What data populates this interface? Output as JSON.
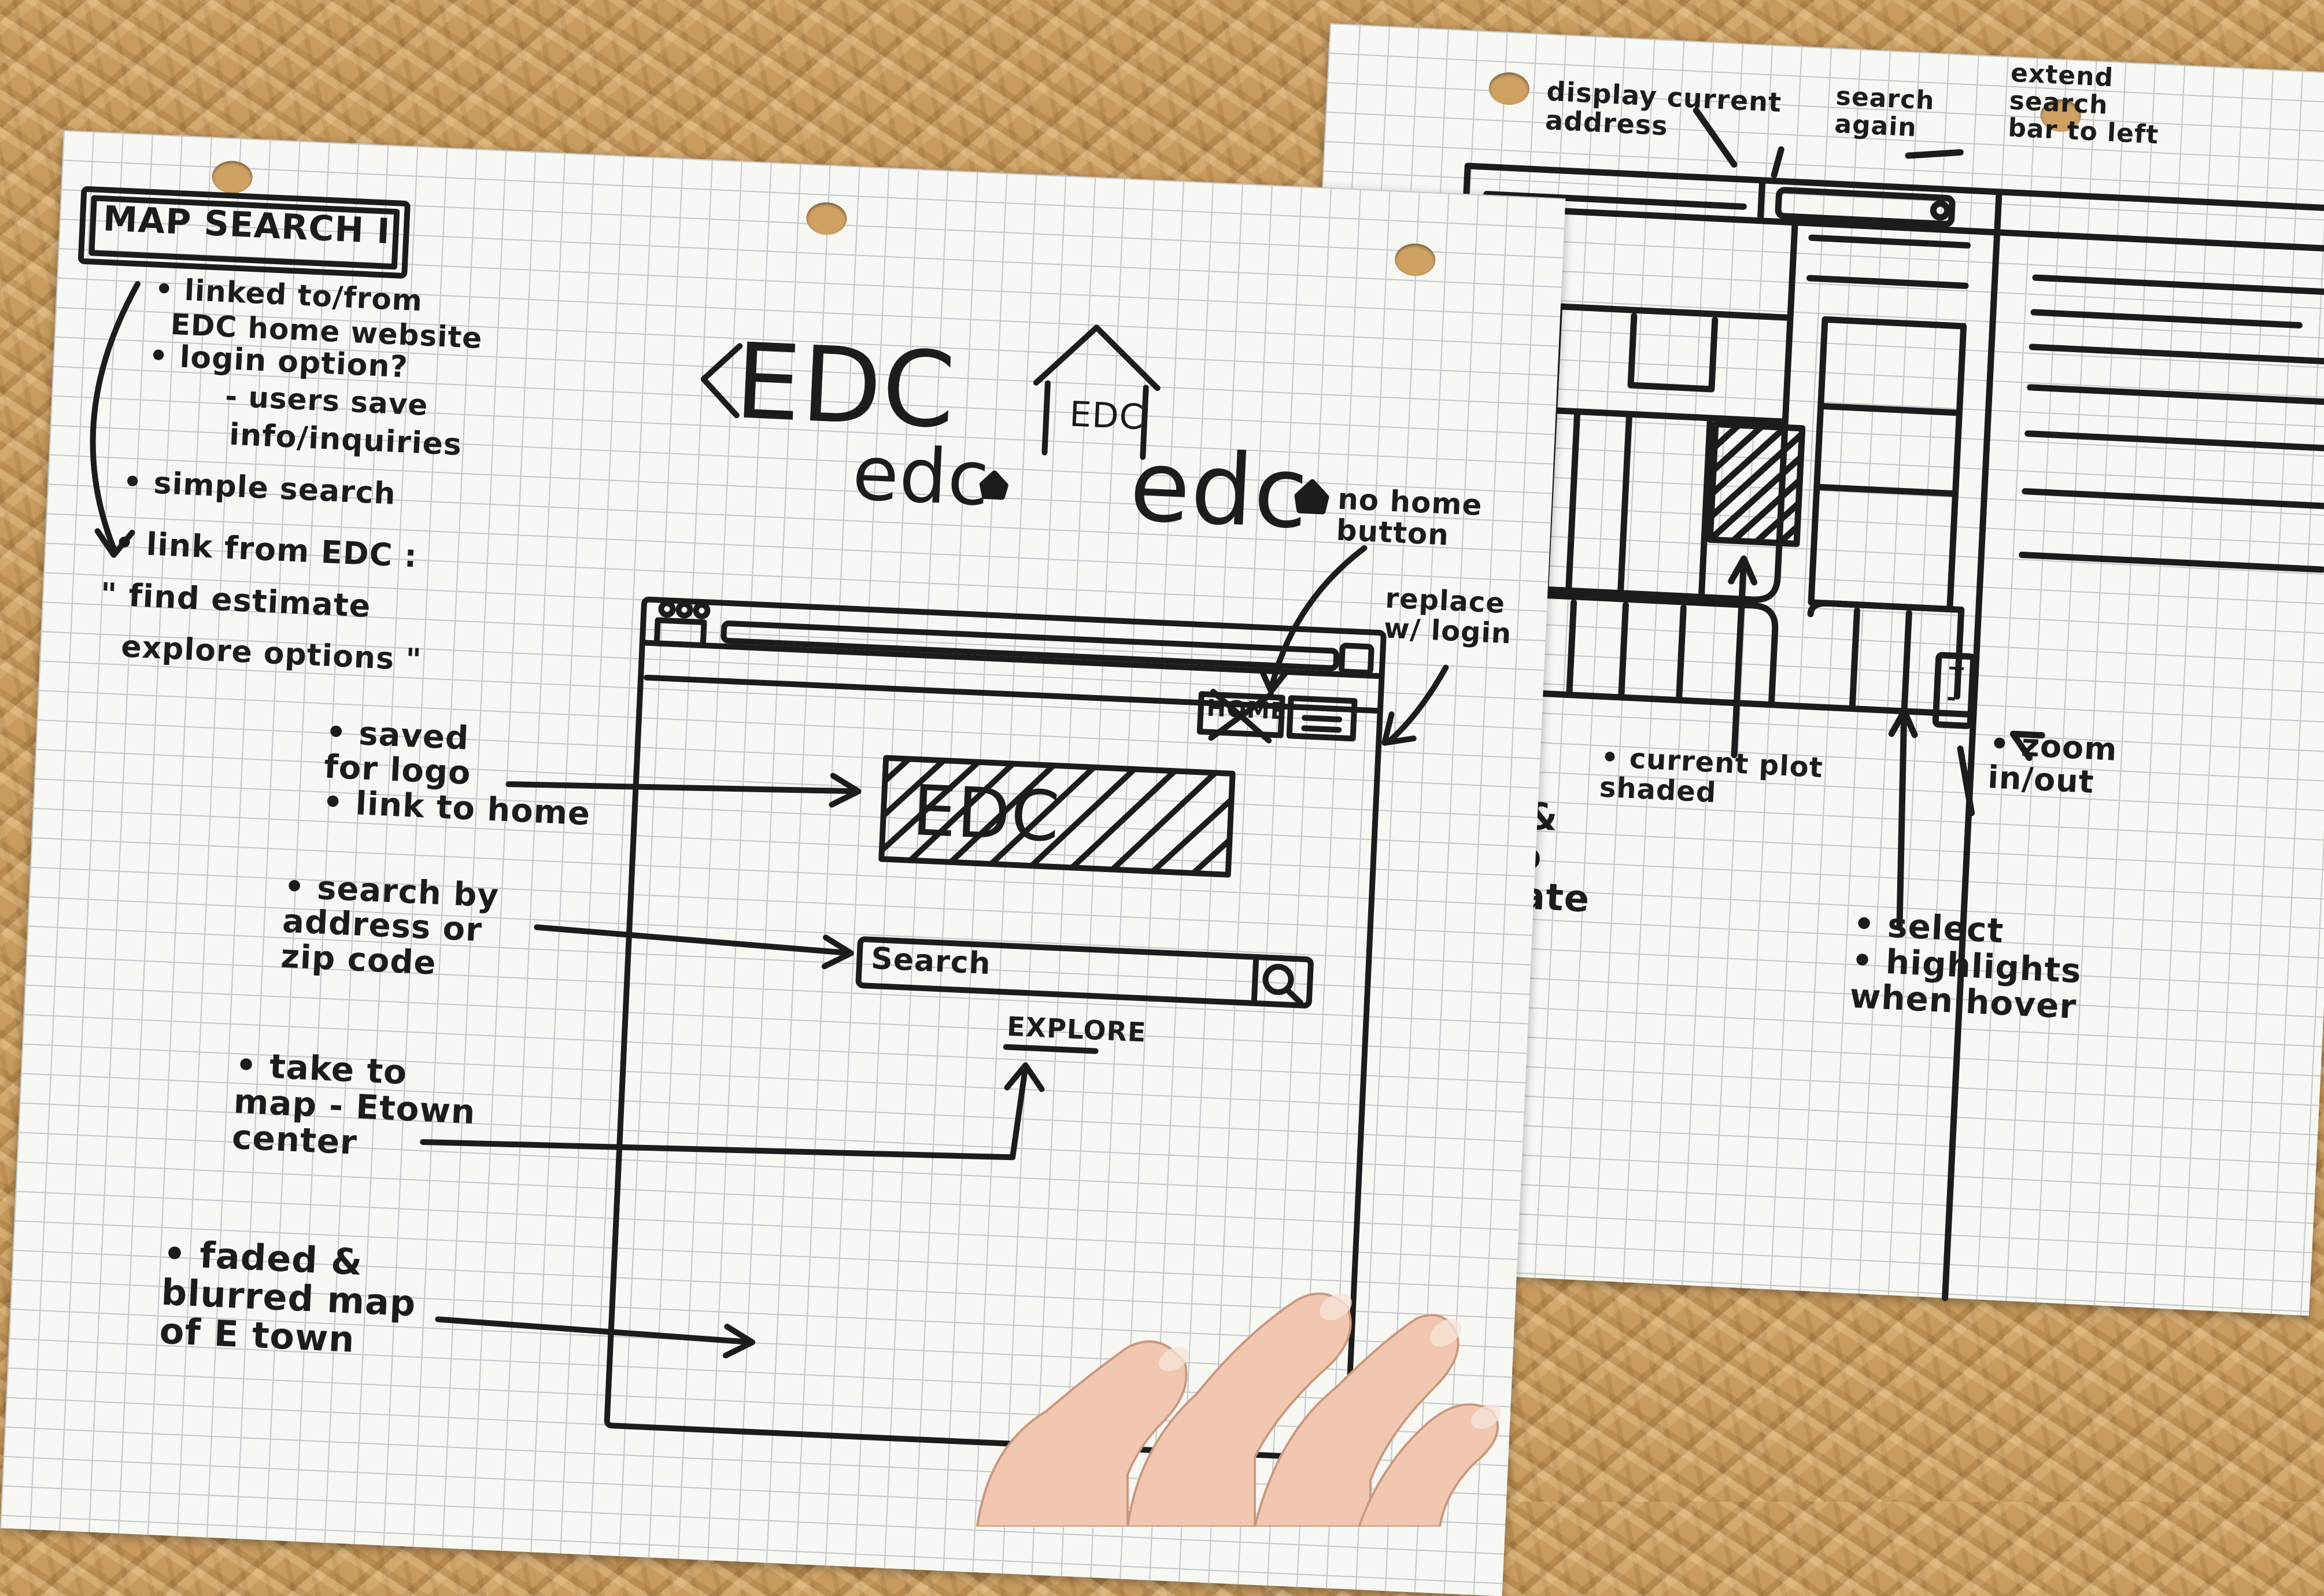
{
  "left_sheet": {
    "title": "MAP SEARCH I",
    "notes": [
      "• linked to/from",
      "EDC home website",
      "• login option?",
      "- users save",
      "info/inquiries",
      "• simple search",
      "• link from EDC :",
      "\" find estimate",
      "explore options \""
    ],
    "logo_variants": {
      "logo_a": "EDC",
      "logo_b": "EDC",
      "logo_c": "edc",
      "logo_d": "edc"
    },
    "annotations": {
      "no_home": "no home\nbutton",
      "replace_login": "replace\nw/ login",
      "saved_logo": "• saved\nfor logo\n• link to home",
      "search_by": "• search by\naddress or\nzip code",
      "take_to": "• take to\nmap - Etown\ncenter",
      "faded": "• faded &\nblurred map\nof E town"
    },
    "wireframe": {
      "home_label": "HOME",
      "logo_text": "EDC",
      "search_placeholder": "Search",
      "explore_label": "EXPLORE"
    }
  },
  "right_sheet": {
    "annotations": {
      "display_current": "display current\naddress",
      "search_again": "search\nagain",
      "extend_search": "extend\nsearch\nbar to left",
      "current_plot": "• current plot\nshaded",
      "zoom": "• zoom\nin/out",
      "drag": "ab &\ng to\nvigate\nap",
      "select": "• select\n• highlights\nwhen hover"
    },
    "zoom_plus": "+",
    "zoom_minus": "-"
  }
}
